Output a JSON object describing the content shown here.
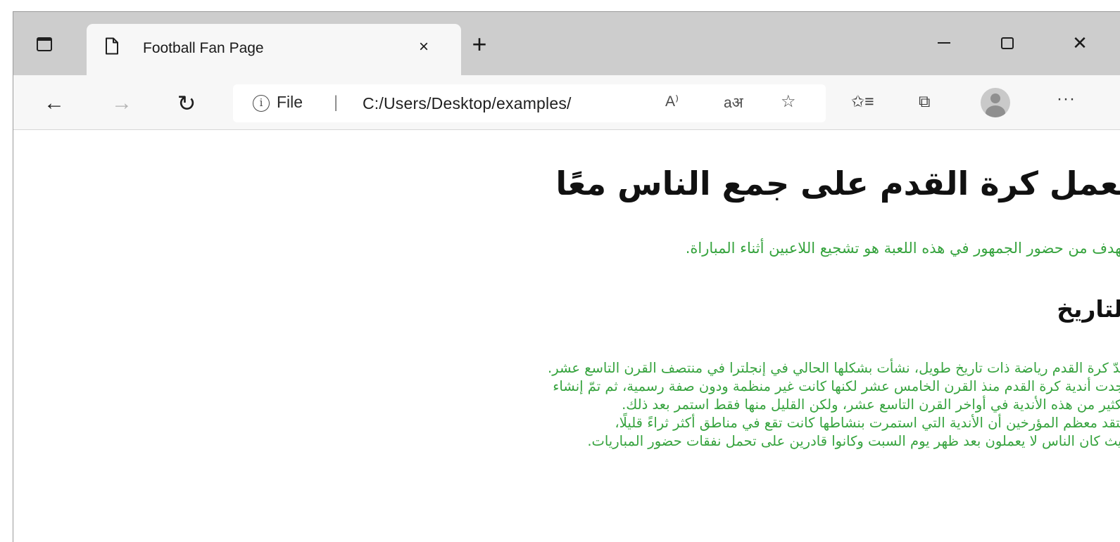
{
  "tab": {
    "title": "Football Fan Page",
    "close": "×"
  },
  "titlebar": {
    "new_tab": "+",
    "close": "✕"
  },
  "toolbar": {
    "back": "←",
    "forward": "→",
    "reload": "↻",
    "info": "i",
    "scheme": "File",
    "separator": "|",
    "url": "C:/Users/Desktop/examples/",
    "read_aloud": "A⁾",
    "translate": "aअ",
    "add_favorite": "☆",
    "favorites": "✩≡",
    "collections": "⧉",
    "more": "···"
  },
  "page": {
    "heading": "تعمل كرة القدم على جمع الناس معًا",
    "intro": "الهدف من حضور الجمهور في هذه اللعبة هو تشجيع اللاعبين أثناء المباراة.",
    "section_title": "التاريخ",
    "history_lines": [
      "تعدّ كرة القدم رياضة ذات تاريخ طويل، نشأت بشكلها الحالي في إنجلترا في منتصف القرن التاسع عشر.",
      "وُجدت أندية كرة القدم منذ القرن الخامس عشر لكنها كانت غير منظمة ودون صفة رسمية، ثم تمّ إنشاء",
      "الكثير من هذه الأندية في أواخر القرن التاسع عشر، ولكن القليل منها فقط استمر بعد ذلك.",
      "يعتقد معظم المؤرخين أن الأندية التي استمرت بنشاطها كانت تقع في مناطق أكثر ثراءً قليلًا،",
      "حيث كان الناس لا يعملون بعد ظهر يوم السبت وكانوا قادرين على تحمل نفقات حضور المباريات."
    ]
  }
}
